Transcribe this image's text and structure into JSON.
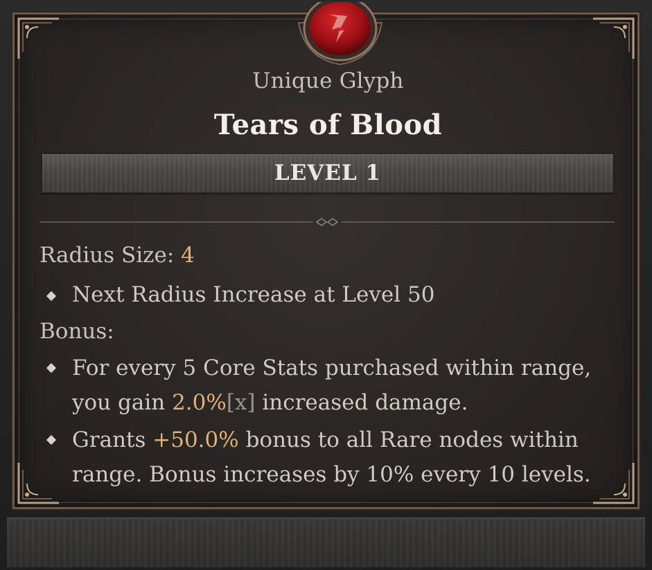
{
  "tooltip": {
    "item_type": "Unique Glyph",
    "item_name": "Tears of Blood",
    "level_label": "LEVEL 1",
    "radius": {
      "label": "Radius Size: ",
      "value": "4"
    },
    "radius_bullet": "Next Radius Increase at Level 50",
    "bonus_label": "Bonus:",
    "bonus_1": {
      "line1": "For every 5 Core Stats purchased within range,",
      "line2_prefix": "you gain ",
      "line2_value": "2.0%",
      "line2_tag": "[x]",
      "line2_suffix": " increased damage."
    },
    "bonus_2": {
      "line1_prefix": "Grants ",
      "line1_value": "+50.0%",
      "line1_suffix": " bonus to all Rare nodes within",
      "line2": "range. Bonus increases by 10% every 10 levels."
    }
  },
  "icons": {
    "glyph": "blood-glyph-icon",
    "bullet": "diamond-bullet-icon",
    "divider": "ornament-divider-icon"
  },
  "colors": {
    "accent": "#e2b078",
    "title": "#f2efe9",
    "body_text": "#cfcac2",
    "frame": "#6d5a4a",
    "gem": "#b3141c"
  }
}
